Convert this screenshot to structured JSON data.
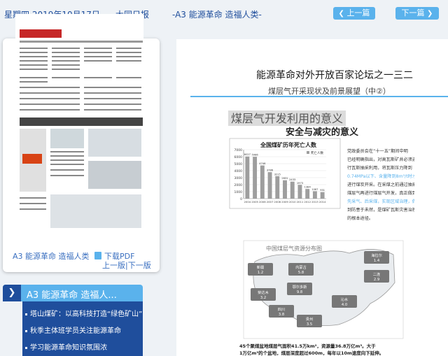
{
  "header": {
    "date": "星期四 2019年10月17日",
    "paper": "大同日报",
    "page_title": "-A3 能源革命 造福人类-",
    "prev_label": "上一篇",
    "next_label": "下一篇"
  },
  "thumbnail": {
    "caption": "A3 能源革命 造福人类",
    "download_label": "下载PDF",
    "prev_page_label": "上一版",
    "separator": "|",
    "next_page_label": "下一版"
  },
  "section": {
    "title": "A3 能源革命 造福人...",
    "items": [
      "塔山煤矿：以高科技打造“绿色矿山”",
      "秋季主体班学员关注能源革命",
      "学习能源革命知识氛围浓"
    ]
  },
  "article": {
    "title": "能源革命对外开放百家论坛之一三二",
    "subtitle": "煤层气开采现状及前景展望（中②）",
    "headline1": "煤层气开发利用的意义",
    "headline2": "安全与减灾的意义",
    "chart_title": "全国煤矿历年死亡人数",
    "chart_legend": "死亡人数",
    "body_text": [
      "党政委员会在“十一五”期间中明",
      "已经明确指出，对高瓦斯矿井必须进",
      "行瓦斯抽采利用，将瓦斯压力降到",
      "0.74MPa以下、含量降到8m³/t时才可",
      "进行煤炭开采。在采煤之前通过抽采",
      "煤层气再进行煤层气开发，真正做到",
      "先采气、后采煤，实现区域治理，做",
      "到防患于未然，是煤矿瓦斯灾害治理",
      "的根本途径。"
    ],
    "map_title": "中国煤层气资源分布图",
    "map_regions": [
      {
        "name": "新疆",
        "value": "1.2"
      },
      {
        "name": "内蒙古",
        "value": "5.8"
      },
      {
        "name": "海拉尔",
        "value": "1.4"
      },
      {
        "name": "二连",
        "value": "2.9"
      },
      {
        "name": "鄂尔多斯",
        "value": "9.8"
      },
      {
        "name": "沁水",
        "value": "4.0"
      },
      {
        "name": "柴达木",
        "value": "3.2"
      },
      {
        "name": "四川",
        "value": "3.8"
      },
      {
        "name": "贵州",
        "value": "3.5"
      }
    ],
    "caption_line1": "45个聚煤盆地煤层气面积41.5万km²，资源量36.8万亿m³。大于",
    "caption_line2": "1万亿m³的个盆地，煤层深度超过600m，每年以10m速度向下延伸。"
  },
  "chart_data": {
    "type": "bar",
    "title": "全国煤矿历年死亡人数",
    "categories": [
      "2004",
      "2005",
      "2006",
      "2007",
      "2008",
      "2009",
      "2010",
      "2011",
      "2012",
      "2013",
      "2014"
    ],
    "series": [
      {
        "name": "死亡人数",
        "values": [
          6027,
          5986,
          4746,
          3786,
          3215,
          2631,
          2433,
          1973,
          1384,
          1067,
          931
        ]
      }
    ],
    "ylim": [
      0,
      7000
    ]
  },
  "colors": {
    "accent": "#5ab2ec",
    "nav_dark": "#1f4e9c",
    "header_text": "#1f4e9c"
  }
}
